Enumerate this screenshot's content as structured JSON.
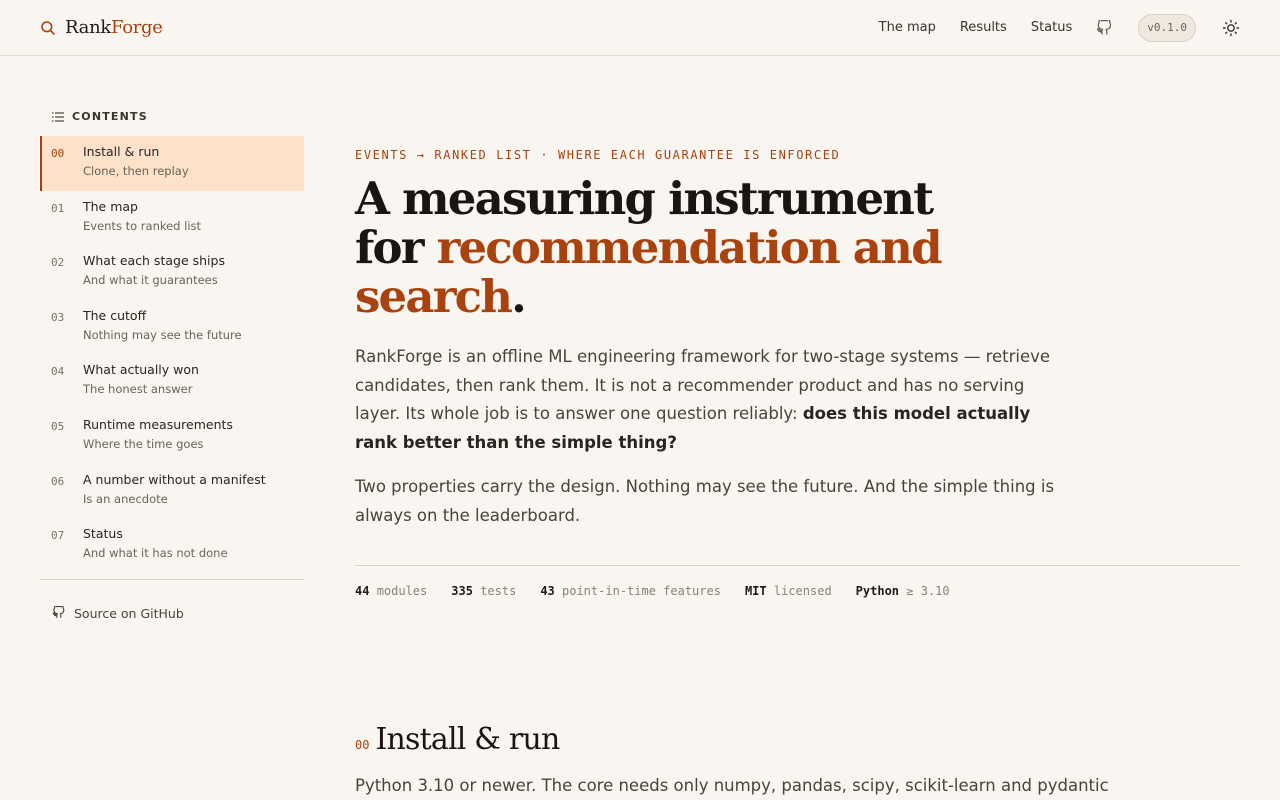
{
  "header": {
    "brand_rank": "Rank",
    "brand_forge": "Forge",
    "nav": [
      "The map",
      "Results",
      "Status"
    ],
    "version": "v0.1.0",
    "icons": {
      "brand": "search-icon",
      "github": "github-icon",
      "theme": "sun-icon"
    }
  },
  "sidebar": {
    "contents_label": "CONTENTS",
    "items": [
      {
        "num": "00",
        "title": "Install & run",
        "sub": "Clone, then replay",
        "active": true
      },
      {
        "num": "01",
        "title": "The map",
        "sub": "Events to ranked list"
      },
      {
        "num": "02",
        "title": "What each stage ships",
        "sub": "And what it guarantees"
      },
      {
        "num": "03",
        "title": "The cutoff",
        "sub": "Nothing may see the future"
      },
      {
        "num": "04",
        "title": "What actually won",
        "sub": "The honest answer"
      },
      {
        "num": "05",
        "title": "Runtime measurements",
        "sub": "Where the time goes"
      },
      {
        "num": "06",
        "title": "A number without a manifest",
        "sub": "Is an anecdote"
      },
      {
        "num": "07",
        "title": "Status",
        "sub": "And what it has not done"
      }
    ],
    "github_link": "Source on GitHub"
  },
  "main": {
    "eyebrow": "EVENTS → RANKED LIST · WHERE EACH GUARANTEE IS ENFORCED",
    "headline_1": "A measuring instrument",
    "headline_2_plain": "for ",
    "headline_2_accent": "recommendation and",
    "headline_3_accent": "search",
    "headline_3_end": ".",
    "lead_text": "RankForge is an offline ML engineering framework for two-stage systems — retrieve candidates, then rank them. It is not a recommender product and has no serving layer. Its whole job is to answer one question reliably: ",
    "lead_bold": "does this model actually rank better than the simple thing?",
    "lead2": "Two properties carry the design. Nothing may see the future. And the simple thing is always on the leaderboard.",
    "stats": [
      {
        "num": "44",
        "label": "modules"
      },
      {
        "num": "335",
        "label": "tests"
      },
      {
        "num": "43",
        "label": "point-in-time features"
      },
      {
        "num": "MIT",
        "label": "licensed"
      },
      {
        "num": "Python",
        "label": "≥ 3.10"
      }
    ],
    "section": {
      "num": "00",
      "heading": "Install & run",
      "lead": "Python 3.10 or newer. The core needs only numpy, pandas, scipy, scikit-learn and pydantic"
    }
  },
  "colors": {
    "accent": "#a8430f",
    "background": "#f9f5f0",
    "active_row": "#fde2c9"
  }
}
